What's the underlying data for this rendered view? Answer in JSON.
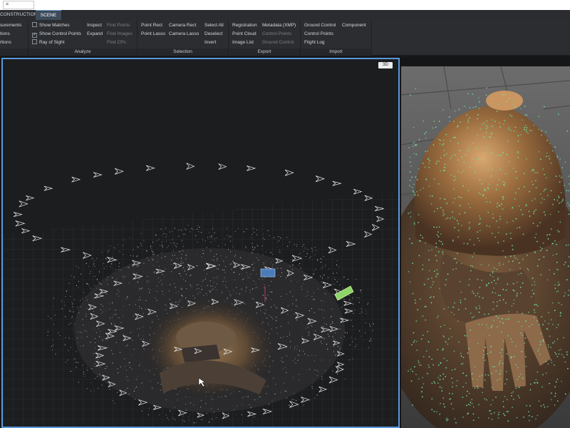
{
  "titlebar": {
    "quick_field_value": "="
  },
  "tabs": [
    {
      "label": "CONSTRUCTION",
      "active": false
    },
    {
      "label": "SCENE",
      "active": true
    }
  ],
  "ribbon": {
    "left_items": [
      "surements",
      "tions",
      "rtions"
    ],
    "analyze": {
      "label": "Analyze",
      "checks": [
        {
          "label": "Show Matches",
          "checked": false
        },
        {
          "label": "Show Control Points",
          "checked": true
        },
        {
          "label": "Ray of Sight",
          "checked": false
        }
      ],
      "col2": [
        "Inspect",
        "Expand"
      ],
      "col3": [
        "Find Points",
        "Find Images",
        "Find CPs"
      ]
    },
    "selection": {
      "label": "Selection",
      "col1": [
        "Point Rect",
        "Point Lasso"
      ],
      "col2": [
        "Camera Rect",
        "Camera Lasso"
      ],
      "col3": [
        "Select All",
        "Deselect",
        "Invert"
      ]
    },
    "export": {
      "label": "Export",
      "col1": [
        "Registration",
        "Point Cloud",
        "Image List"
      ],
      "col2": [
        "Metadata (XMP)",
        "Control Points",
        "Ground Control"
      ]
    },
    "import": {
      "label": "Import",
      "col1": [
        "Ground Control",
        "Control Points",
        "Flight Log"
      ],
      "col2": [
        "Component"
      ]
    }
  },
  "viewport": {
    "mode_button": "3D"
  },
  "colors": {
    "accent": "#5a98dc",
    "tie_points": "#6fe3a0",
    "bronze": "#8a6a45"
  }
}
